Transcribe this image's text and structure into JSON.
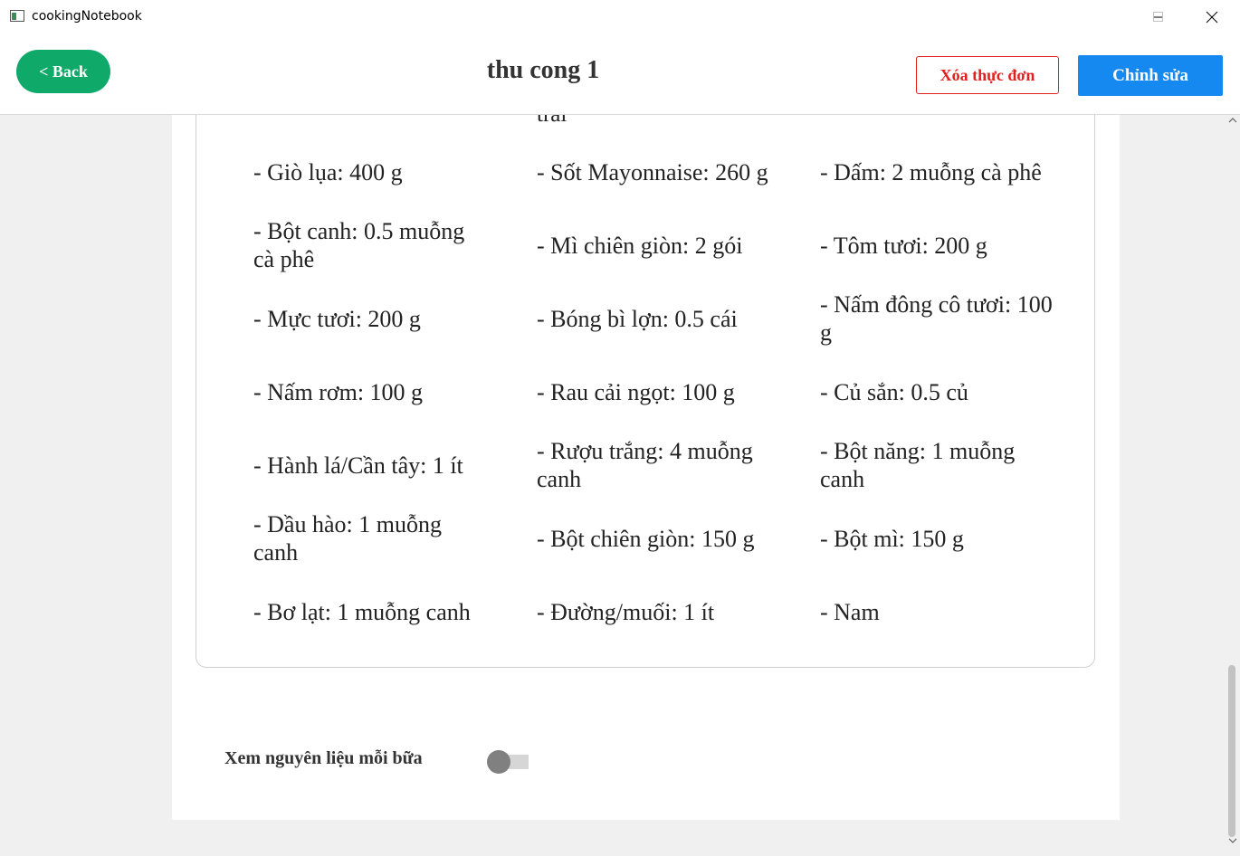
{
  "window": {
    "title": "cookingNotebook"
  },
  "header": {
    "back_label": "< Back",
    "title": "thu cong 1",
    "delete_label": "Xóa thực đơn",
    "edit_label": "Chỉnh sửa"
  },
  "ingredients": {
    "cut_text": "trái",
    "items": [
      "- Giò lụa: 400 g",
      "- Sốt Mayonnaise: 260 g",
      "- Dấm: 2 muỗng cà phê",
      "- Bột canh: 0.5 muỗng cà phê",
      "- Mì chiên giòn: 2 gói",
      "- Tôm tươi: 200 g",
      "- Mực tươi: 200 g",
      "- Bóng bì lợn: 0.5 cái",
      "- Nấm đông cô tươi: 100 g",
      "- Nấm rơm: 100 g",
      "- Rau cải ngọt: 100 g",
      "- Củ sắn: 0.5 củ",
      "- Hành lá/Cần tây: 1 ít",
      "- Rượu trắng: 4 muỗng canh",
      "- Bột năng: 1 muỗng canh",
      "- Dầu hào: 1 muỗng canh",
      "- Bột chiên giòn: 150 g",
      "- Bột mì: 150 g",
      "- Bơ lạt: 1 muỗng canh",
      "- Đường/muối: 1 ít",
      "- Nam"
    ]
  },
  "toggle": {
    "label": "Xem nguyên liệu mỗi bữa",
    "on": false
  },
  "colors": {
    "back": "#0fa96a",
    "delete": "#e21f1f",
    "edit": "#1589f0"
  }
}
